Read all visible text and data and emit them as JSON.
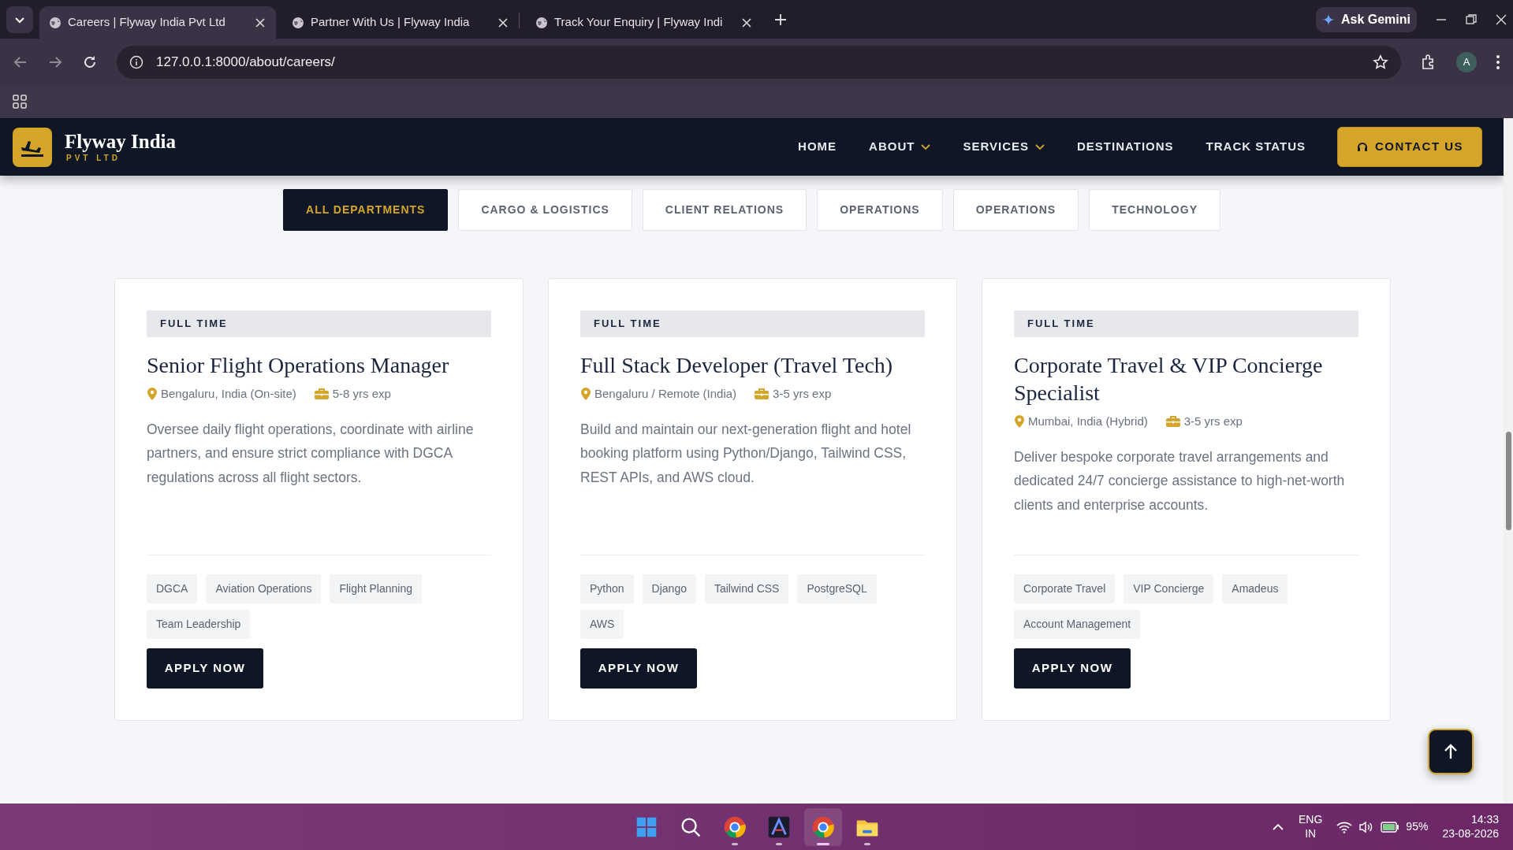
{
  "browser": {
    "tabs": [
      {
        "title": "Careers | Flyway India Pvt Ltd",
        "selected": true
      },
      {
        "title": "Partner With Us | Flyway India",
        "selected": false
      },
      {
        "title": "Track Your Enquiry | Flyway Indi",
        "selected": false
      }
    ],
    "gemini": "Ask Gemini",
    "url": "127.0.0.1:8000/about/careers/",
    "profile": "A"
  },
  "navbar": {
    "brand": "Flyway India",
    "brand_sub": "PVT LTD",
    "links": [
      {
        "label": "HOME",
        "has_dropdown": false
      },
      {
        "label": "ABOUT",
        "has_dropdown": true
      },
      {
        "label": "SERVICES",
        "has_dropdown": true
      },
      {
        "label": "DESTINATIONS",
        "has_dropdown": false
      },
      {
        "label": "TRACK STATUS",
        "has_dropdown": false
      }
    ],
    "cta": "CONTACT US"
  },
  "filters": [
    {
      "label": "ALL DEPARTMENTS",
      "selected": true
    },
    {
      "label": "CARGO & LOGISTICS",
      "selected": false
    },
    {
      "label": "CLIENT RELATIONS",
      "selected": false
    },
    {
      "label": "OPERATIONS",
      "selected": false
    },
    {
      "label": "OPERATIONS",
      "selected": false
    },
    {
      "label": "TECHNOLOGY",
      "selected": false
    }
  ],
  "jobs": [
    {
      "type": "FULL TIME",
      "title": "Senior Flight Operations Manager",
      "location": "Bengaluru, India (On-site)",
      "experience": "5-8 yrs exp",
      "description": "Oversee daily flight operations, coordinate with airline partners, and ensure strict compliance with DGCA regulations across all flight sectors.",
      "tags": [
        "DGCA",
        "Aviation Operations",
        "Flight Planning",
        "Team Leadership"
      ],
      "button": "APPLY NOW"
    },
    {
      "type": "FULL TIME",
      "title": "Full Stack Developer (Travel Tech)",
      "location": "Bengaluru / Remote (India)",
      "experience": "3-5 yrs exp",
      "description": "Build and maintain our next-generation flight and hotel booking platform using Python/Django, Tailwind CSS, REST APIs, and AWS cloud.",
      "tags": [
        "Python",
        "Django",
        "Tailwind CSS",
        "PostgreSQL",
        "AWS"
      ],
      "button": "APPLY NOW"
    },
    {
      "type": "FULL TIME",
      "title": "Corporate Travel & VIP Concierge Specialist",
      "location": "Mumbai, India (Hybrid)",
      "experience": "3-5 yrs exp",
      "description": "Deliver bespoke corporate travel arrangements and dedicated 24/7 concierge assistance to high-net-worth clients and enterprise accounts.",
      "tags": [
        "Corporate Travel",
        "VIP Concierge",
        "Amadeus",
        "Account Management"
      ],
      "button": "APPLY NOW"
    }
  ],
  "taskbar": {
    "apps": [
      {
        "kind": "start",
        "running": false,
        "selected": false
      },
      {
        "kind": "search",
        "running": false,
        "selected": false
      },
      {
        "kind": "chrome",
        "running": true,
        "selected": false
      },
      {
        "kind": "editor",
        "running": true,
        "selected": false
      },
      {
        "kind": "chrome",
        "running": true,
        "selected": true
      },
      {
        "kind": "folder",
        "running": true,
        "selected": false
      }
    ],
    "language": "ENG",
    "region": "IN",
    "battery": "95%",
    "time": "14:33",
    "date": "23-08-2026"
  }
}
